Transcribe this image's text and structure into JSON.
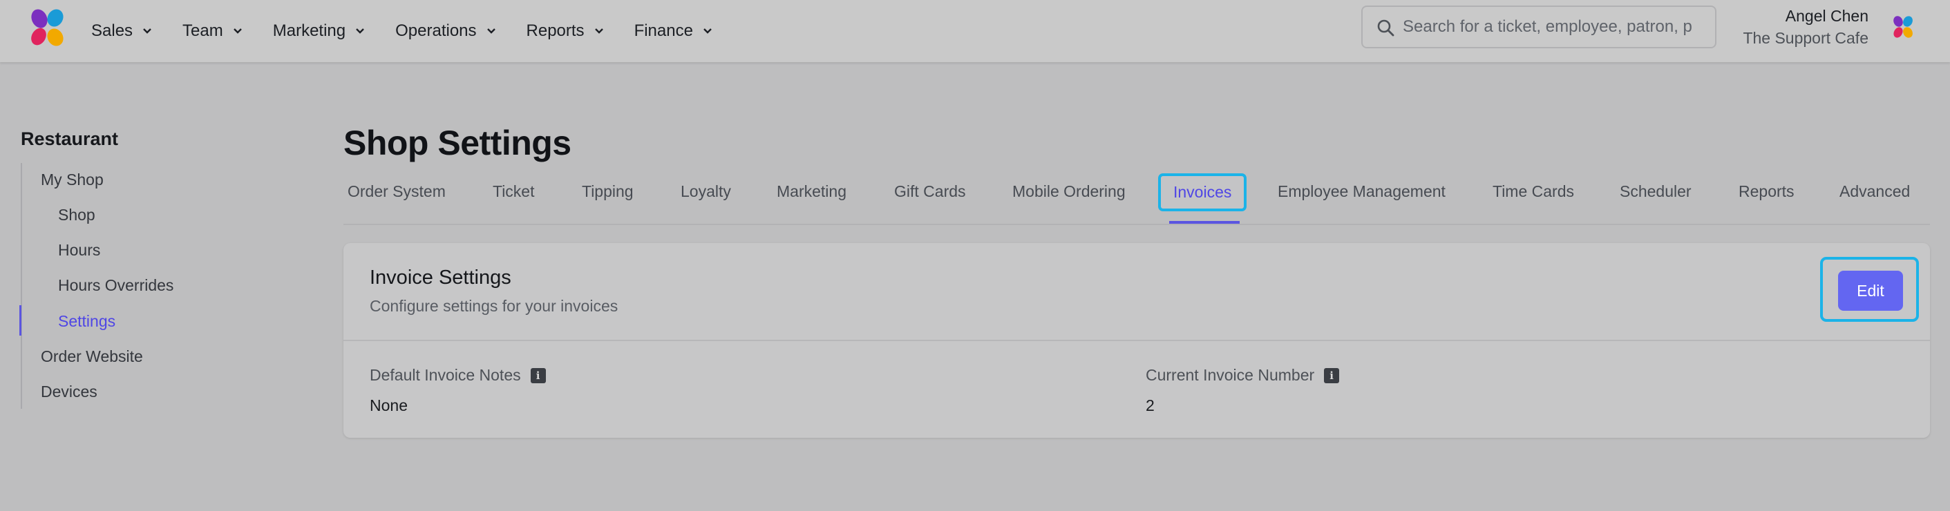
{
  "header": {
    "nav": [
      {
        "label": "Sales"
      },
      {
        "label": "Team"
      },
      {
        "label": "Marketing"
      },
      {
        "label": "Operations"
      },
      {
        "label": "Reports"
      },
      {
        "label": "Finance"
      }
    ],
    "search_placeholder": "Search for a ticket, employee, patron, p",
    "user_name": "Angel Chen",
    "user_org": "The Support Cafe"
  },
  "sidebar": {
    "title": "Restaurant",
    "items": [
      {
        "label": "My Shop"
      },
      {
        "label": "Shop"
      },
      {
        "label": "Hours"
      },
      {
        "label": "Hours Overrides"
      },
      {
        "label": "Settings",
        "active": true
      },
      {
        "label": "Order Website"
      },
      {
        "label": "Devices"
      }
    ]
  },
  "main": {
    "title": "Shop Settings",
    "tabs": [
      {
        "label": "Order System"
      },
      {
        "label": "Ticket"
      },
      {
        "label": "Tipping"
      },
      {
        "label": "Loyalty"
      },
      {
        "label": "Marketing"
      },
      {
        "label": "Gift Cards"
      },
      {
        "label": "Mobile Ordering"
      },
      {
        "label": "Invoices",
        "active": true
      },
      {
        "label": "Employee Management"
      },
      {
        "label": "Time Cards"
      },
      {
        "label": "Scheduler"
      },
      {
        "label": "Reports"
      },
      {
        "label": "Advanced"
      }
    ],
    "card": {
      "title": "Invoice Settings",
      "subtitle": "Configure settings for your invoices",
      "edit_label": "Edit",
      "fields": [
        {
          "label": "Default Invoice Notes",
          "value": "None"
        },
        {
          "label": "Current Invoice Number",
          "value": "2"
        }
      ]
    }
  },
  "colors": {
    "accent": "#6366f1",
    "active_text": "#4f46e5",
    "focus_ring": "#1bb3e8"
  }
}
